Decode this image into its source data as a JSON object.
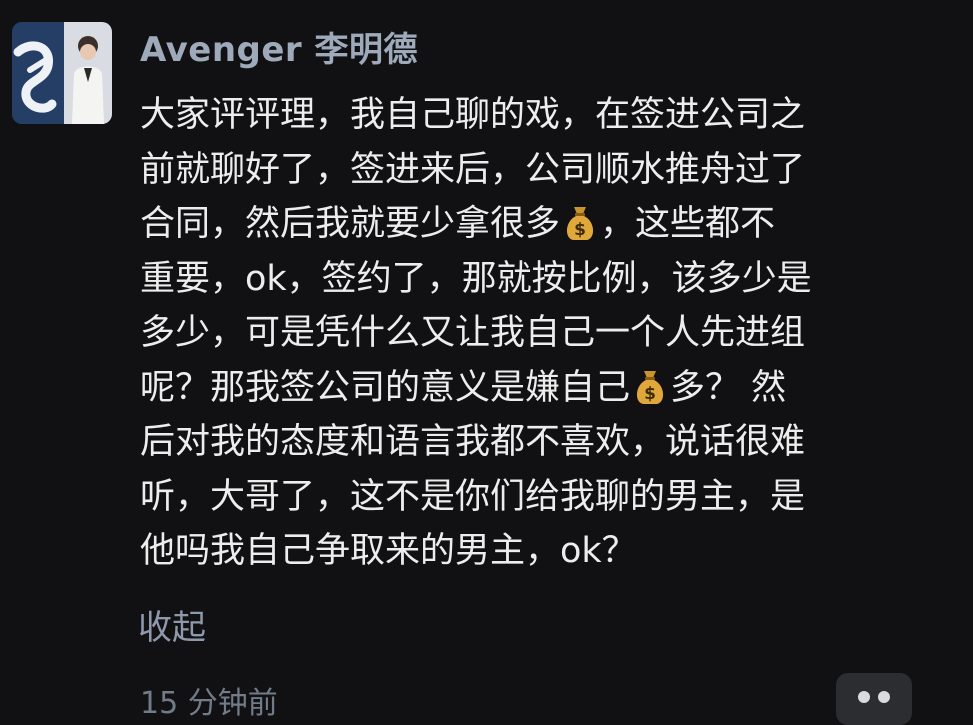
{
  "post": {
    "author": "Avenger 李明德",
    "content_lines": [
      "大家评评理，我自己聊的戏，在签进公司之",
      "前就聊好了，签进来后，公司顺水推舟过了",
      [
        "合同，然后我就要少拿很多",
        "💰",
        "，这些都不"
      ],
      "重要，ok，签约了，那就按比例，该多少是",
      "多少，可是凭什么又让我自己一个人先进组",
      [
        "呢？那我签公司的意义是嫌自己",
        "💰",
        "多？ 然"
      ],
      "后对我的态度和语言我都不喜欢，说话很难",
      "听，大哥了，这不是你们给我聊的男主，是",
      "他吗我自己争取来的男主，ok？"
    ],
    "collapse_label": "收起",
    "timestamp": "15 分钟前"
  },
  "icons": {
    "avatar": "avatar-image",
    "money_bag": "money-bag-icon",
    "more": "more-options-icon"
  }
}
